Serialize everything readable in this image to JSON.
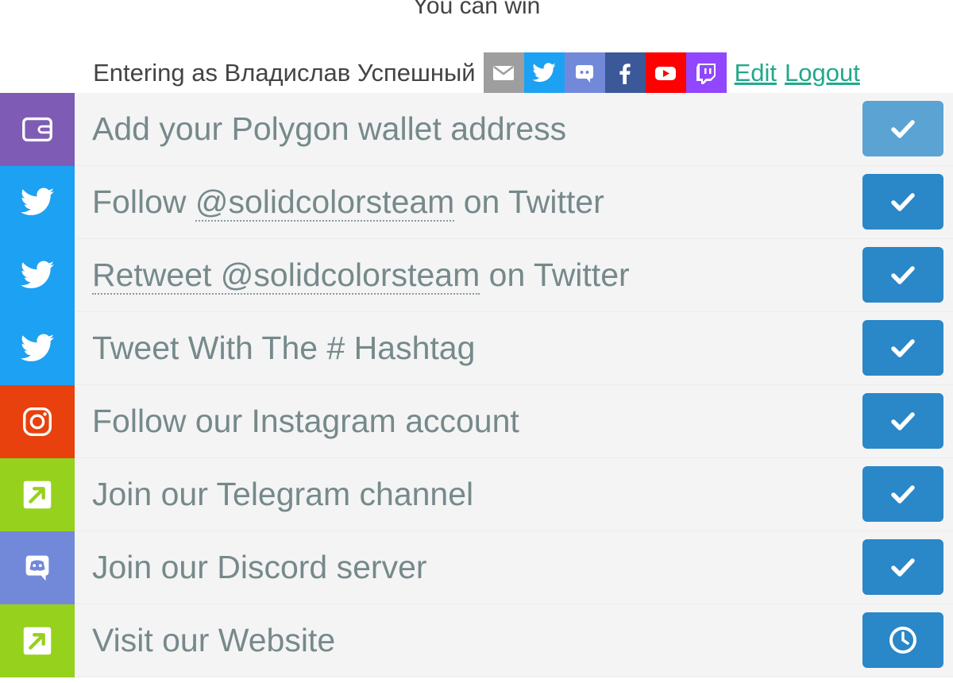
{
  "header": {
    "title": "You can win",
    "entering_label": "Entering as Владислав Успешный",
    "edit_label": "Edit",
    "logout_label": "Logout",
    "social_buttons": [
      {
        "name": "email",
        "color": "#9e9e9e"
      },
      {
        "name": "twitter",
        "color": "#1da1f2"
      },
      {
        "name": "discord",
        "color": "#7289da"
      },
      {
        "name": "facebook",
        "color": "#3b5998"
      },
      {
        "name": "youtube",
        "color": "#ff0000"
      },
      {
        "name": "twitch",
        "color": "#9146ff"
      }
    ]
  },
  "entries": [
    {
      "prefix": "Add your Polygon wallet address",
      "link": "",
      "suffix": "",
      "icon": "wallet-icon",
      "icon_color": "#7e5bb5",
      "status": "done",
      "action_icon": "check-icon",
      "action_color": "#5aa3d3"
    },
    {
      "prefix": "Follow ",
      "link": "@solidcolorsteam",
      "suffix": " on Twitter",
      "icon": "twitter-icon",
      "icon_color": "#1da1f2",
      "status": "done",
      "action_icon": "check-icon",
      "action_color": "#2a87c8"
    },
    {
      "prefix": "",
      "link": "Retweet @solidcolorsteam",
      "suffix": " on Twitter",
      "icon": "twitter-icon",
      "icon_color": "#1da1f2",
      "status": "done",
      "action_icon": "check-icon",
      "action_color": "#2a87c8"
    },
    {
      "prefix": "Tweet With The # Hashtag",
      "link": "",
      "suffix": "",
      "icon": "twitter-icon",
      "icon_color": "#1da1f2",
      "status": "done",
      "action_icon": "check-icon",
      "action_color": "#2a87c8"
    },
    {
      "prefix": "Follow our Instagram account",
      "link": "",
      "suffix": "",
      "icon": "instagram-icon",
      "icon_color": "#e8410e",
      "status": "done",
      "action_icon": "check-icon",
      "action_color": "#2a87c8"
    },
    {
      "prefix": "Join our Telegram channel",
      "link": "",
      "suffix": "",
      "icon": "external-link-icon",
      "icon_color": "#96d11e",
      "status": "done",
      "action_icon": "check-icon",
      "action_color": "#2a87c8"
    },
    {
      "prefix": "Join our Discord server",
      "link": "",
      "suffix": "",
      "icon": "discord-icon",
      "icon_color": "#7289da",
      "status": "done",
      "action_icon": "check-icon",
      "action_color": "#2a87c8"
    },
    {
      "prefix": "Visit our Website",
      "link": "",
      "suffix": "",
      "icon": "external-link-icon",
      "icon_color": "#96d11e",
      "status": "pending",
      "action_icon": "clock-icon",
      "action_color": "#2a87c8"
    }
  ]
}
